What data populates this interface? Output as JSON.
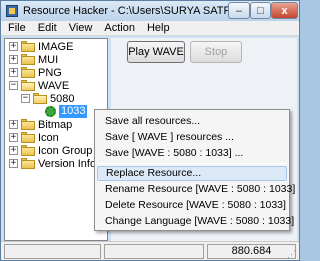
{
  "window": {
    "title": "Resource Hacker - C:\\Users\\SURYA SATRIA\\Deskto...",
    "controls": {
      "minimize": "–",
      "maximize": "□",
      "close": "x"
    }
  },
  "menubar": {
    "items": [
      "File",
      "Edit",
      "View",
      "Action",
      "Help"
    ]
  },
  "tree": {
    "items": [
      {
        "label": "IMAGE",
        "level": 0,
        "expander": "+"
      },
      {
        "label": "MUI",
        "level": 0,
        "expander": "+"
      },
      {
        "label": "PNG",
        "level": 0,
        "expander": "+"
      },
      {
        "label": "WAVE",
        "level": 0,
        "expander": "−"
      },
      {
        "label": "5080",
        "level": 1,
        "expander": "−"
      },
      {
        "label": "1033",
        "level": 2,
        "selected": true
      },
      {
        "label": "Bitmap",
        "level": 0,
        "expander": "+"
      },
      {
        "label": "Icon",
        "level": 0,
        "expander": "+"
      },
      {
        "label": "Icon Group",
        "level": 0,
        "expander": "+"
      },
      {
        "label": "Version Info",
        "level": 0,
        "expander": "+"
      }
    ]
  },
  "toolbar": {
    "play_label": "Play WAVE",
    "stop_label": "Stop"
  },
  "context_menu": {
    "items": [
      "Save all resources...",
      "Save [ WAVE ] resources ...",
      "Save [WAVE : 5080 : 1033] ...",
      "Replace Resource...",
      "Rename Resource [WAVE : 5080 : 1033]",
      "Delete Resource [WAVE : 5080 : 1033]",
      "Change Language [WAVE : 5080 : 1033]"
    ],
    "hovered": "Replace Resource..."
  },
  "statusbar": {
    "cells": [
      "",
      "",
      "880.684"
    ]
  },
  "colors": {
    "selection": "#3399ff",
    "menu_hover": "#dce9f7",
    "folder": "#e9c24f",
    "gear": "#3da83d"
  }
}
